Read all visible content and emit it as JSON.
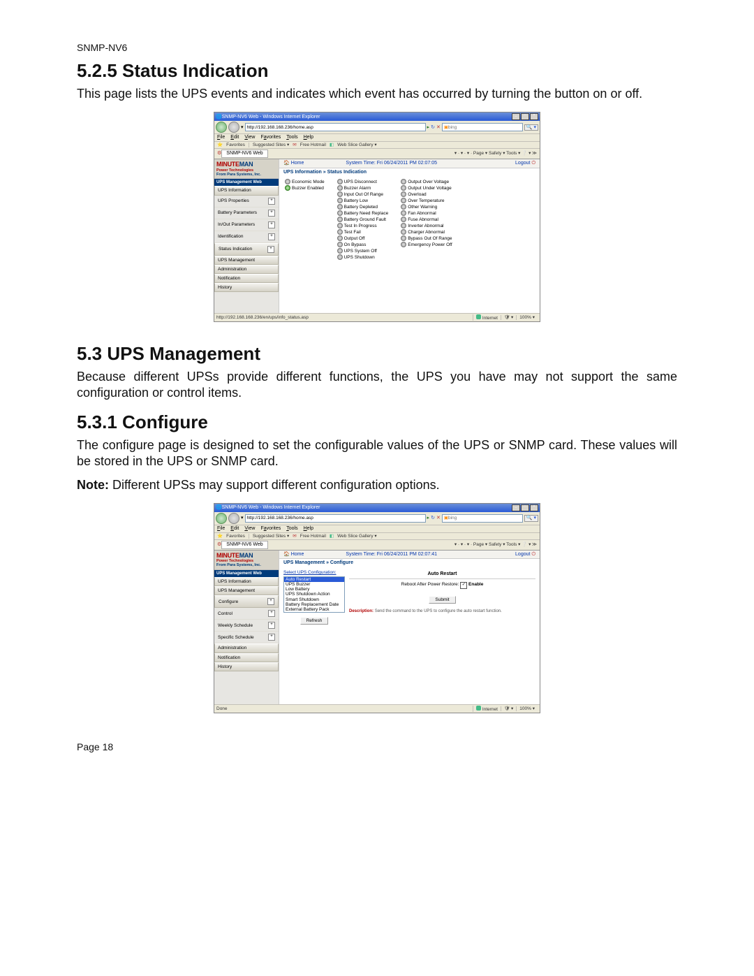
{
  "doc": {
    "header": "SNMP-NV6",
    "h1": "5.2.5 Status Indication",
    "p1": "This page lists the UPS events and indicates which event has occurred by turning the button on or off.",
    "h2": "5.3 UPS Management",
    "p2": "Because different UPSs provide different functions, the UPS you have may not support the same configuration or control items.",
    "h3": "5.3.1 Configure",
    "p3": "The configure page is designed to set the configurable values of the UPS or SNMP card. These values will be stored in the UPS or SNMP card.",
    "note_bold": "Note:",
    "note_rest": " Different UPSs may support different configuration options.",
    "footer": "Page 18"
  },
  "ie": {
    "title": "SNMP-NV6 Web - Windows Internet Explorer",
    "url1": "http://192.168.168.236/home.asp",
    "url2": "http://192.168.168.236/home.asp",
    "search_ph": "bing",
    "menu": [
      "File",
      "Edit",
      "View",
      "Favorites",
      "Tools",
      "Help"
    ],
    "fav_label": "Favorites",
    "fav_links": [
      "Suggested Sites ▾",
      "Free Hotmail",
      "Web Slice Gallery ▾"
    ],
    "tab": "SNMP-NV6 Web",
    "tools": "▾  ·  ▾  ·  ▾  ·  Page ▾  Safety ▾  Tools ▾  ❔ ▾  ≫",
    "status1_left": "http://192.168.168.236/en/ups/info_status.asp",
    "status2_left": "Done",
    "sb_internet": "Internet",
    "sb_zoom": "100%  ▾"
  },
  "app": {
    "logo_a": "MINUTE",
    "logo_b": "MAN",
    "logo_sub": "Power Technologies",
    "logo_sub2": "From Para Systems, Inc.",
    "side_title": "UPS Management Web",
    "home": "Home",
    "systime1": "System Time: Fri 06/24/2011 PM 02:07:05",
    "systime2": "System Time: Fri 06/24/2011 PM 02:07:41",
    "logout": "Logout",
    "bc1": "UPS Information » Status Indication",
    "bc2": "UPS Management » Configure",
    "cats": {
      "info": "UPS Information",
      "mgmt": "UPS Management",
      "admin": "Administration",
      "notif": "Notification",
      "hist": "History"
    },
    "items1": [
      "UPS Properties",
      "Battery Parameters",
      "In/Out Parameters",
      "Identification",
      "Status Indication"
    ],
    "items2": [
      "Configure",
      "Control",
      "Weekly Schedule",
      "Specific Schedule"
    ],
    "status_col1": [
      "Economic Mode",
      "Buzzer Enabled"
    ],
    "status_col2": [
      "UPS Disconnect",
      "Buzzer Alarm",
      "Input Out Of Range",
      "Battery Low",
      "Battery Depleted",
      "Battery Need Replace",
      "Battery Ground Fault",
      "Test In Progress",
      "Test Fail",
      "Output Off",
      "On Bypass",
      "UPS System Off",
      "UPS Shutdown"
    ],
    "status_col3": [
      "Output Over Voltage",
      "Output Under Voltage",
      "Overload",
      "Over Temperature",
      "Other Warning",
      "Fan Abnormal",
      "Fuse Abnormal",
      "Inverter Abnormal",
      "Charger Abnormal",
      "Bypass Out Of Range",
      "Emergency Power Off"
    ],
    "cfg_panel_title": "Select UPS Configuration:",
    "cfg_options": [
      "Auto Restart",
      "UPS Buzzer",
      "Low Battery",
      "UPS Shutdown Action",
      "Smart Shutdown",
      "Battery Replacement Date",
      "External Battery Pack"
    ],
    "cfg_refresh": "Refresh",
    "auto_title": "Auto Restart",
    "auto_line": "Reboot After Power Restore:",
    "auto_enable": "Enable",
    "submit": "Submit",
    "desc_label": "Description:",
    "desc_text": "Send the command to the UPS to configure the auto restart function."
  }
}
